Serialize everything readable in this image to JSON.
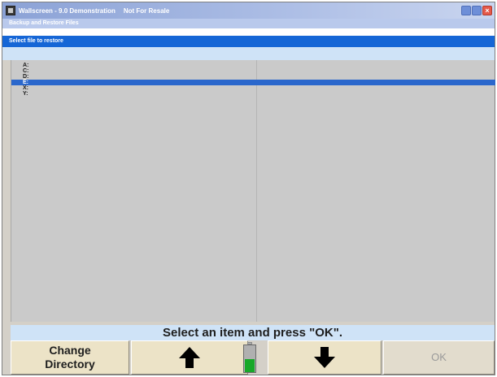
{
  "window": {
    "title": "Wallscreen - 9.0 Demonstration",
    "title_extra": "Not For Resale",
    "controls": [
      "minimize",
      "maximize",
      "close"
    ],
    "close_glyph": "×"
  },
  "menu": {
    "label": "Backup and Restore Files"
  },
  "dialog": {
    "header": "Select file to restore"
  },
  "drives": [
    {
      "label": "A:",
      "selected": false
    },
    {
      "label": "C:",
      "selected": false
    },
    {
      "label": "D:",
      "selected": false
    },
    {
      "label": "E:",
      "selected": true
    },
    {
      "label": "X:",
      "selected": false
    },
    {
      "label": "Y:",
      "selected": false
    }
  ],
  "prompt": "Select an item and press \"OK\".",
  "toolbar": {
    "change_directory_line1": "Change",
    "change_directory_line2": "Directory",
    "up_icon": "arrow-up-icon",
    "down_icon": "arrow-down-icon",
    "ok_label": "OK",
    "ok_enabled": false
  },
  "battery": {
    "level": 0.5,
    "color": "#18a829"
  },
  "colors": {
    "selection": "#2a67cc",
    "header": "#1566d6",
    "list_bg": "#cacaca",
    "prompt_bg": "#cfe3f7",
    "button_bg": "#ece3c7"
  }
}
